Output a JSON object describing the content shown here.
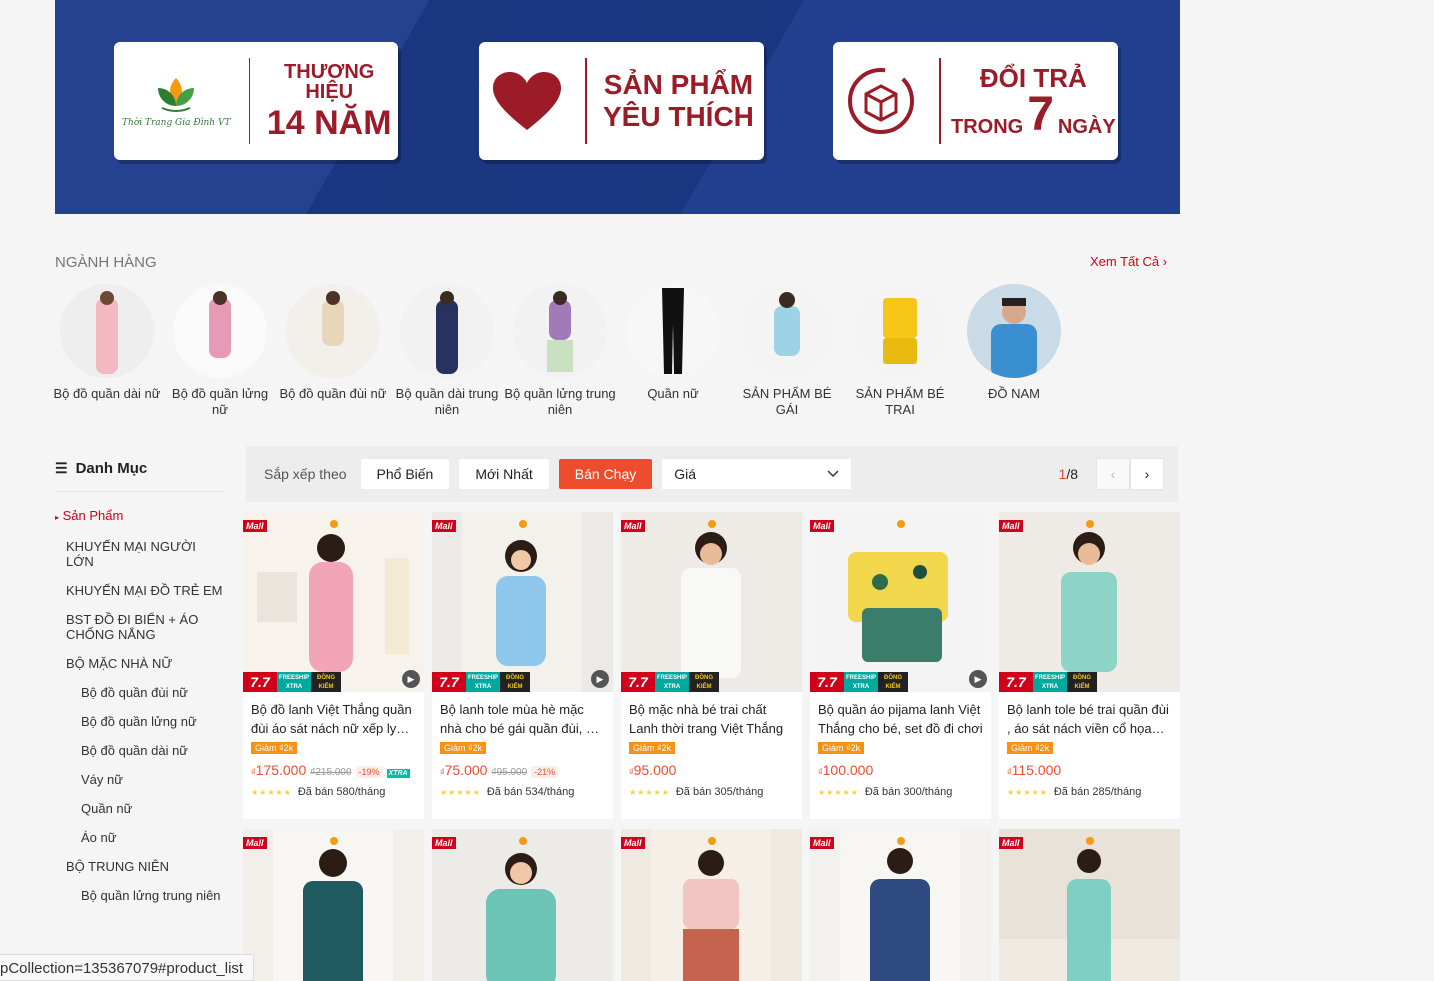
{
  "banner": {
    "card1": {
      "line1": "THƯƠNG HIỆU",
      "line2": "14 NĂM",
      "logo_text": "Thời Trang Gia Đình VT"
    },
    "card2": {
      "line1": "SẢN PHẨM",
      "line2": "YÊU THÍCH"
    },
    "card3": {
      "line1": "ĐỔI TRẢ",
      "trong": "TRONG",
      "num": "7",
      "ngay": "NGÀY"
    }
  },
  "categories": {
    "title": "NGÀNH HÀNG",
    "see_all": "Xem Tất Cả",
    "items": [
      {
        "label": "Bộ đồ quần dài nữ"
      },
      {
        "label": "Bộ đồ quần lửng nữ"
      },
      {
        "label": "Bộ đồ quần đùi nữ"
      },
      {
        "label": "Bộ quần dài trung niên"
      },
      {
        "label": "Bộ quần lửng trung niên"
      },
      {
        "label": "Quần nữ"
      },
      {
        "label": "SẢN PHẨM BÉ GÁI"
      },
      {
        "label": "SẢN PHẨM BÉ TRAI"
      },
      {
        "label": "ĐỒ NAM"
      }
    ]
  },
  "sidebar": {
    "title": "Danh Mục",
    "items": [
      {
        "label": "Sản Phẩm"
      },
      {
        "label": "KHUYẾN MẠI NGƯỜI LỚN"
      },
      {
        "label": "KHUYẾN MẠI ĐỒ TRẺ EM"
      },
      {
        "label": "BST ĐỒ ĐI BIỂN + ÁO CHỐNG NẮNG"
      },
      {
        "label": "BỘ MẶC NHÀ NỮ"
      },
      {
        "label": "Bộ đồ quần đùi nữ"
      },
      {
        "label": "Bộ đồ quần lửng nữ"
      },
      {
        "label": "Bộ đồ quần dài nữ"
      },
      {
        "label": "Váy nữ"
      },
      {
        "label": "Quần nữ"
      },
      {
        "label": "Áo nữ"
      },
      {
        "label": "BỘ TRUNG NIÊN"
      },
      {
        "label": "Bộ quần lửng trung niên"
      }
    ]
  },
  "sort": {
    "label": "Sắp xếp theo",
    "popular": "Phổ Biến",
    "newest": "Mới Nhất",
    "best": "Bán Chạy",
    "price": "Giá",
    "page_current": "1",
    "page_total": "/8"
  },
  "products": [
    {
      "name": "Bộ đồ lanh Việt Thắng quần đùi áo sát nách nữ xếp ly nhẹ nhàng",
      "voucher": "Giảm ₫2k",
      "currency": "₫",
      "price": "175.000",
      "old": "₫215.000",
      "disc": "-19%",
      "xtra": "XTRA",
      "sold": "Đã bán 580/tháng",
      "stars": "★★★★★"
    },
    {
      "name": "Bộ lanh tole mùa hè mặc nhà cho bé gái quần đùi, áo sát nách",
      "voucher": "Giảm ₫2k",
      "currency": "₫",
      "price": "75.000",
      "old": "₫95.000",
      "disc": "-21%",
      "xtra": "",
      "sold": "Đã bán 534/tháng",
      "stars": "★★★★★"
    },
    {
      "name": "Bộ mặc nhà bé trai chất Lanh thời trang Việt Thắng",
      "voucher": "Giảm ₫2k",
      "currency": "₫",
      "price": "95.000",
      "old": "",
      "disc": "",
      "xtra": "",
      "sold": "Đã bán 305/tháng",
      "stars": "★★★★★"
    },
    {
      "name": "Bộ quần áo pijama lanh Việt Thắng cho bé, set đồ đi chơi",
      "voucher": "Giảm ₫2k",
      "currency": "₫",
      "price": "100.000",
      "old": "",
      "disc": "",
      "xtra": "",
      "sold": "Đã bán 300/tháng",
      "stars": "★★★★★"
    },
    {
      "name": "Bộ lanh tole bé trai quần đùi , áo sát nách viền cổ họa tiết",
      "voucher": "Giảm ₫2k",
      "currency": "₫",
      "price": "115.000",
      "old": "",
      "disc": "",
      "xtra": "",
      "sold": "Đã bán 285/tháng",
      "stars": "★★★★★"
    }
  ],
  "badges": {
    "mall": "Mall",
    "sale": "7.7",
    "freeship": "FREESHIP XTRA",
    "dongkiem": "ĐỒNG KIỂM"
  },
  "status_url": "pCollection=135367079#product_list",
  "colors": {
    "brand_red": "#d0011b",
    "shopee_orange": "#ee4d2d",
    "banner_blue": "#1c3a8c"
  }
}
